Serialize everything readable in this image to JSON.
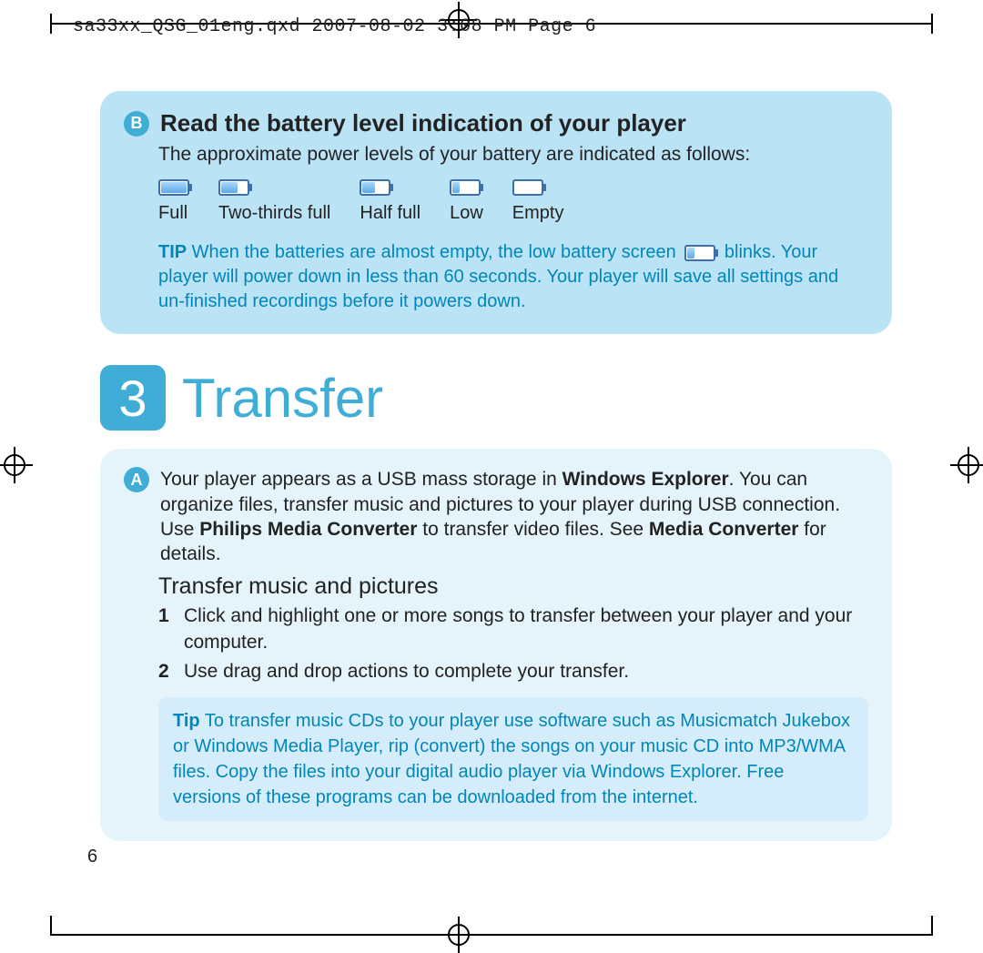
{
  "header": "sa33xx_QSG_01eng.qxd  2007-08-02  3:08 PM  Page 6",
  "page_number": "6",
  "card1": {
    "bullet": "B",
    "title": "Read the battery level indication of your player",
    "intro": "The approximate power levels of your battery are indicated as follows:",
    "levels": [
      "Full",
      "Two-thirds full",
      "Half full",
      "Low",
      "Empty"
    ],
    "tip_label": "TIP",
    "tip_before": " When the batteries are almost empty, the low battery screen ",
    "tip_after": " blinks. Your player will power down in less than 60 seconds. Your player will save all settings and un-finished recordings before it powers down."
  },
  "chapter": {
    "num": "3",
    "title": "Transfer"
  },
  "card2": {
    "bullet": "A",
    "para_pre": "Your player appears as a USB mass storage in ",
    "para_b1": "Windows Explorer",
    "para_mid1": ". You can organize files, transfer music and pictures to your player during USB connection. Use ",
    "para_b2": "Philips Media Converter",
    "para_mid2": " to transfer video files. See ",
    "para_b3": "Media Converter",
    "para_post": " for details.",
    "subhead": "Transfer music and pictures",
    "steps": [
      "Click and highlight one or more songs to transfer between your player and your computer.",
      "Use drag and drop actions to complete your transfer."
    ],
    "tip_label": "Tip",
    "tip_text": " To transfer music CDs to your player use software such as Musicmatch Jukebox or Windows Media Player, rip (convert) the songs on your music CD into MP3/WMA files. Copy the files into your digital audio player via Windows Explorer. Free versions of these programs can be downloaded from the internet."
  }
}
